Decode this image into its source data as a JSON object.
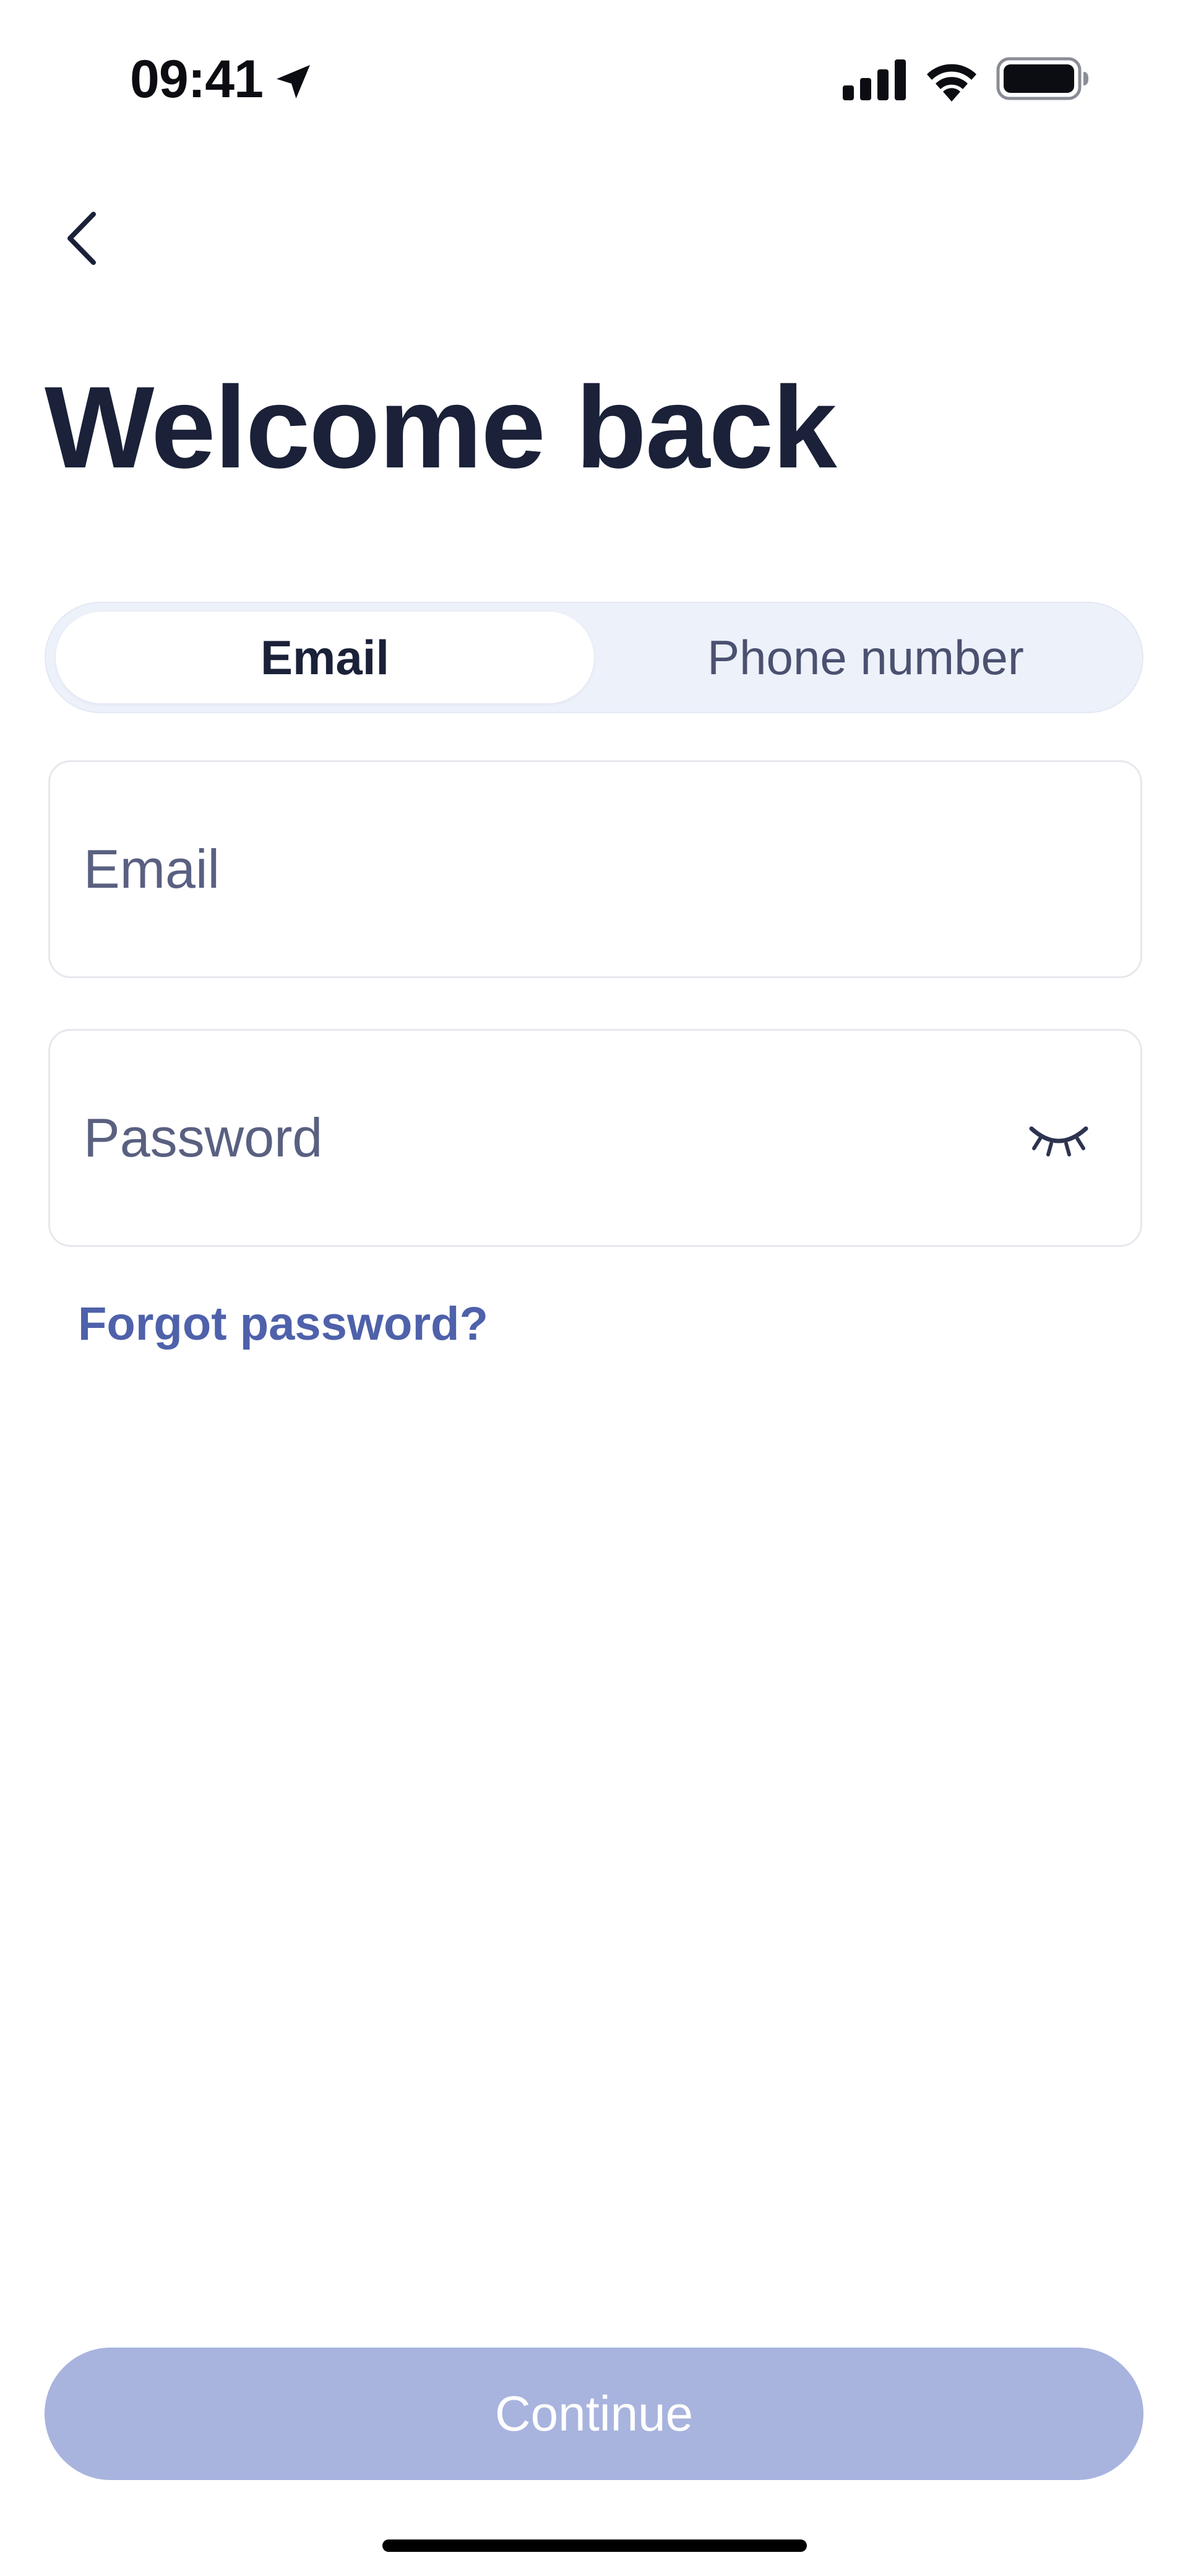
{
  "status_bar": {
    "time": "09:41",
    "icons": [
      "location-arrow-icon",
      "cellular-signal-icon",
      "wifi-icon",
      "battery-icon"
    ]
  },
  "header": {
    "back_icon": "chevron-left-icon"
  },
  "title": "Welcome back",
  "tabs": [
    {
      "label": "Email",
      "active": true
    },
    {
      "label": "Phone number",
      "active": false
    }
  ],
  "form": {
    "email": {
      "value": "",
      "placeholder": "Email"
    },
    "password": {
      "value": "",
      "placeholder": "Password",
      "toggle_icon": "eye-closed-icon"
    },
    "forgot_label": "Forgot password?"
  },
  "continue_label": "Continue",
  "colors": {
    "title": "#1a2138",
    "link": "#4e61aa",
    "button_disabled": "#a8b4de",
    "segment_bg": "#edf1fa",
    "field_border": "#e6e8ee"
  }
}
